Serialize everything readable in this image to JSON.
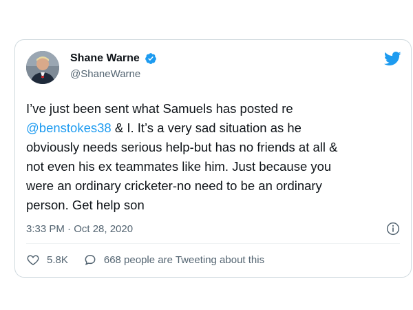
{
  "tweet": {
    "display_name": "Shane Warne",
    "handle": "@ShaneWarne",
    "text_before": "I’ve just been sent what Samuels has posted re\n",
    "mention": "@benstokes38",
    "text_after": " & I. It’s a very sad situation as he\nobviously needs serious help-but has no friends at all &\nnot even his ex teammates like him. Just because you\nwere an ordinary cricketer-no need to be an ordinary\nperson. Get help son",
    "timestamp": "3:33 PM · Oct 28, 2020",
    "likes": "5.8K",
    "tweeting_about": "668 people are Tweeting about this"
  },
  "icons": {
    "logo": "twitter-bird-icon",
    "verified": "verified-badge-icon",
    "info": "info-icon",
    "like": "heart-icon",
    "reply": "speech-bubble-icon"
  },
  "colors": {
    "accent": "#1d9bf0",
    "text": "#0f1419",
    "secondary": "#536471",
    "border": "#cfd9de"
  }
}
